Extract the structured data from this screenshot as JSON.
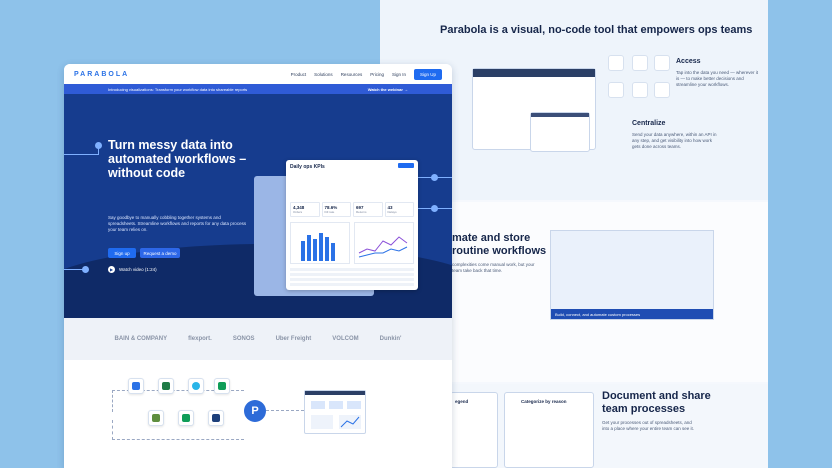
{
  "back_page": {
    "headline": "Parabola is a visual, no-code tool that empowers ops teams",
    "access": {
      "title": "Access",
      "text": "Tap into the data you need — wherever it is — to make better decisions and streamline your workflows."
    },
    "centralize": {
      "title": "Centralize",
      "text": "Send your data anywhere, within an API in any step, and get visibility into how work gets done across teams."
    },
    "automate": {
      "title_line1": "mate and store",
      "title_line2": "routine workflows",
      "text": "complexities come manual work, but your team take back that time."
    },
    "panel_footer": "Build, connect, and automate custom processes",
    "document": {
      "title": "Document and share team processes",
      "text": "Get your processes out of spreadsheets, and into a place where your entire team can see it."
    },
    "flow_card_title": "Categorize by reason",
    "legend_label": "egend"
  },
  "nav": {
    "logo": "PARABOLA",
    "links": [
      "Product",
      "Solutions",
      "Resources",
      "Pricing",
      "Sign In"
    ],
    "cta": "Sign Up"
  },
  "banner": {
    "text": "Introducing visualizations: Transform your workflow data into shareable reports",
    "link": "Watch the webinar →"
  },
  "hero": {
    "title": "Turn messy data into automated workflows – without code",
    "subtitle": "Say goodbye to manually cobbling together systems and spreadsheets. Streamline workflows and reports for any data process your team relies on.",
    "primary_button": "Sign up",
    "secondary_button": "Request a demo",
    "watch_label": "Watch video (1:24)"
  },
  "dashboard": {
    "title": "Daily ops KPIs",
    "kpis": [
      {
        "value": "4,348",
        "label": "Orders"
      },
      {
        "value": "78.6%",
        "label": "Fill rate"
      },
      {
        "value": "697",
        "label": "Returns"
      },
      {
        "value": "43",
        "label": "Delays"
      }
    ]
  },
  "logos": [
    "BAIN & COMPANY",
    "flexport.",
    "SONOS",
    "Uber Freight",
    "VOLCOM",
    "Dunkin'"
  ],
  "colors": {
    "background": "#8ec2ea",
    "hero": "#163c8e",
    "accent": "#1f6bf0",
    "banner": "#2f5bd6"
  }
}
